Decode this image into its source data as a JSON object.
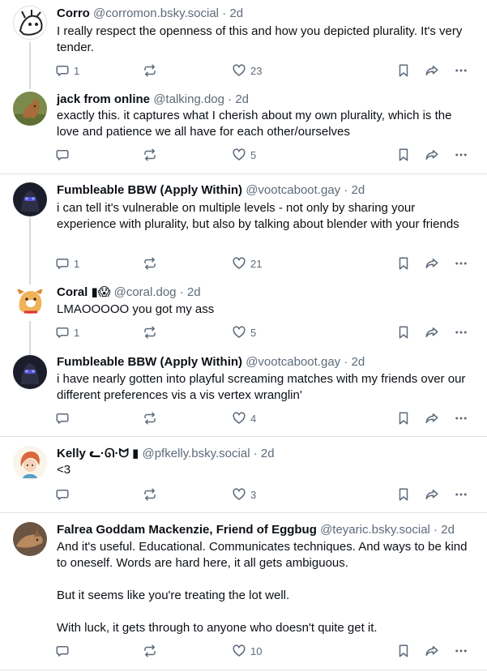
{
  "posts": [
    {
      "name": "Corro",
      "handle": "@corromon.bsky.social",
      "time": "2d",
      "text": "I really respect the openness of this and how you depicted plurality. It's very tender.",
      "replies": "1",
      "likes": "23",
      "avatar_icon": "white-creature-sketch-avatar"
    },
    {
      "name": "jack from online",
      "handle": "@talking.dog",
      "time": "2d",
      "text": "exactly this. it captures what I cherish about my own plurality, which is the love and patience we all have for each other/ourselves",
      "replies": "",
      "likes": "5",
      "avatar_icon": "jackal-photo-avatar"
    },
    {
      "name": "Fumbleable BBW (Apply Within)",
      "handle": "@vootcaboot.gay",
      "time": "2d",
      "text": "i can tell it's vulnerable on multiple levels - not only by sharing your experience with plurality, but also by talking about blender with your friends",
      "replies": "1",
      "likes": "21",
      "avatar_icon": "dark-robot-avatar"
    },
    {
      "name": "Coral",
      "name_emoji": "▮😱",
      "handle": "@coral.dog",
      "time": "2d",
      "text": "LMAOOOOO you got my ass",
      "replies": "1",
      "likes": "5",
      "avatar_icon": "cartoon-dog-avatar"
    },
    {
      "name": "Fumbleable BBW (Apply Within)",
      "handle": "@vootcaboot.gay",
      "time": "2d",
      "text": "i have nearly gotten into playful screaming matches with my friends over our different preferences vis a vis vertex wranglin'",
      "replies": "",
      "likes": "4",
      "avatar_icon": "dark-robot-avatar"
    },
    {
      "name": "Kelly",
      "name_emoji": "ᓚ·ᘏ·ᗢ ▮",
      "handle": "@pfkelly.bsky.social",
      "time": "2d",
      "text": "<3",
      "replies": "",
      "likes": "3",
      "avatar_icon": "redhead-character-avatar"
    },
    {
      "name": "Falrea Goddam Mackenzie, Friend of Eggbug",
      "handle": "@teyaric.bsky.social",
      "time": "2d",
      "text": "And it's useful. Educational. Communicates techniques. And ways to be kind to oneself. Words are hard here, it all gets ambiguous.\n\nBut it seems like you're treating the lot well.\n\nWith luck, it gets through to anyone who doesn't quite get it.",
      "replies": "",
      "likes": "10",
      "avatar_icon": "fox-photo-avatar"
    }
  ],
  "separator": " · ",
  "colors": {
    "text": "#0b0f14",
    "muted": "#5d6b7b",
    "divider": "#dfe3e8",
    "thread_line": "#d4dbe2"
  },
  "icons": {
    "reply": "reply-bubble-icon",
    "repost": "repost-arrows-icon",
    "like": "heart-icon",
    "save": "bookmark-icon",
    "share": "share-arrow-icon",
    "more": "more-dots-icon"
  }
}
